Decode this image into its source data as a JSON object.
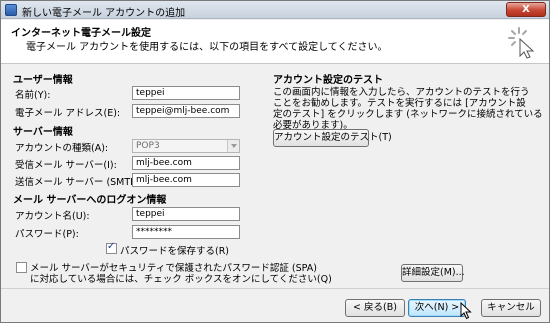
{
  "window": {
    "title": "新しい電子メール アカウントの追加",
    "close_label": "X"
  },
  "header": {
    "title": "インターネット電子メール設定",
    "subtitle": "電子メール アカウントを使用するには、以下の項目をすべて設定してください。"
  },
  "user_info": {
    "heading": "ユーザー情報",
    "name_label": "名前(Y):",
    "name_value": "teppei",
    "email_label": "電子メール アドレス(E):",
    "email_value": "teppei@mlj-bee.com"
  },
  "server_info": {
    "heading": "サーバー情報",
    "account_type_label": "アカウントの種類(A):",
    "account_type_value": "POP3",
    "incoming_label": "受信メール サーバー(I):",
    "incoming_value": "mlj-bee.com",
    "outgoing_label": "送信メール サーバー (SMTP)(O):",
    "outgoing_value": "mlj-bee.com"
  },
  "logon_info": {
    "heading": "メール サーバーへのログオン情報",
    "account_name_label": "アカウント名(U):",
    "account_name_value": "teppei",
    "password_label": "パスワード(P):",
    "password_value": "********",
    "remember_password_label": "パスワードを保存する(R)",
    "remember_password_checked": true,
    "spa_label_line1": "メール サーバーがセキュリティで保護されたパスワード認証 (SPA)",
    "spa_label_line2": "に対応している場合には、チェック ボックスをオンにしてください(Q)",
    "spa_checked": false
  },
  "test": {
    "heading": "アカウント設定のテスト",
    "description_lines": [
      "この画面内に情報を入力したら、アカウントのテストを行う",
      "ことをお勧めします。テストを実行するには [アカウント設",
      "定のテスト] をクリックします (ネットワークに接続されている",
      "必要があります)。"
    ],
    "test_button": "アカウント設定のテスト(T)"
  },
  "buttons": {
    "more_settings": "詳細設定(M)...",
    "back": "< 戻る(B)",
    "next": "次へ(N) >",
    "cancel": "キャンセル"
  }
}
